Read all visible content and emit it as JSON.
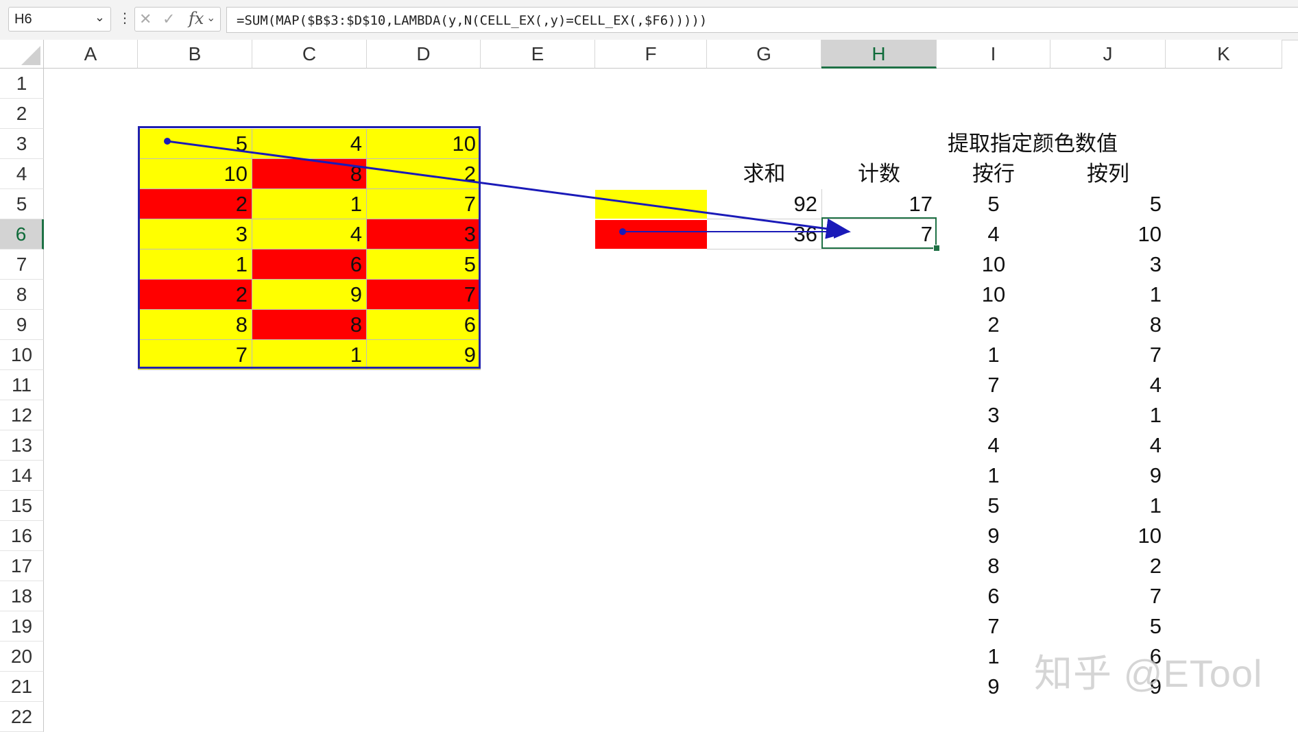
{
  "formula_bar": {
    "name_box": "H6",
    "menu_glyph": "⋮",
    "cancel_glyph": "✕",
    "enter_glyph": "✓",
    "fx_label": "fx",
    "formula": "=SUM(MAP($B$3:$D$10,LAMBDA(y,N(CELL_EX(,y)=CELL_EX(,$F6)))))"
  },
  "columns": [
    "A",
    "B",
    "C",
    "D",
    "E",
    "F",
    "G",
    "H",
    "I",
    "J",
    "K"
  ],
  "active_column": "H",
  "rows": [
    "1",
    "2",
    "3",
    "4",
    "5",
    "6",
    "7",
    "8",
    "9",
    "10",
    "11",
    "12",
    "13",
    "14",
    "15",
    "16",
    "17",
    "18",
    "19",
    "20",
    "21",
    "22"
  ],
  "active_row": "6",
  "colors": {
    "yellow": "#ffff00",
    "red": "#ff0000",
    "border": "#2020b0",
    "selection": "#1e7145"
  },
  "data_table": {
    "rows": [
      [
        {
          "v": "5",
          "c": "yellow"
        },
        {
          "v": "4",
          "c": "yellow"
        },
        {
          "v": "10",
          "c": "yellow"
        }
      ],
      [
        {
          "v": "10",
          "c": "yellow"
        },
        {
          "v": "8",
          "c": "red"
        },
        {
          "v": "2",
          "c": "yellow"
        }
      ],
      [
        {
          "v": "2",
          "c": "red"
        },
        {
          "v": "1",
          "c": "yellow"
        },
        {
          "v": "7",
          "c": "yellow"
        }
      ],
      [
        {
          "v": "3",
          "c": "yellow"
        },
        {
          "v": "4",
          "c": "yellow"
        },
        {
          "v": "3",
          "c": "red"
        }
      ],
      [
        {
          "v": "1",
          "c": "yellow"
        },
        {
          "v": "6",
          "c": "red"
        },
        {
          "v": "5",
          "c": "yellow"
        }
      ],
      [
        {
          "v": "2",
          "c": "red"
        },
        {
          "v": "9",
          "c": "yellow"
        },
        {
          "v": "7",
          "c": "red"
        }
      ],
      [
        {
          "v": "8",
          "c": "yellow"
        },
        {
          "v": "8",
          "c": "red"
        },
        {
          "v": "6",
          "c": "yellow"
        }
      ],
      [
        {
          "v": "7",
          "c": "yellow"
        },
        {
          "v": "1",
          "c": "yellow"
        },
        {
          "v": "9",
          "c": "yellow"
        }
      ]
    ]
  },
  "summary": {
    "header_sum": "求和",
    "header_count": "计数",
    "rows": [
      {
        "color": "yellow",
        "sum": "92",
        "count": "17"
      },
      {
        "color": "red",
        "sum": "36",
        "count": "7"
      }
    ]
  },
  "extract": {
    "title": "提取指定颜色数值",
    "by_row_label": "按行",
    "by_col_label": "按列",
    "by_row": [
      "5",
      "4",
      "10",
      "10",
      "2",
      "1",
      "7",
      "3",
      "4",
      "1",
      "5",
      "9",
      "8",
      "6",
      "7",
      "1",
      "9"
    ],
    "by_col": [
      "5",
      "10",
      "3",
      "1",
      "8",
      "7",
      "4",
      "1",
      "4",
      "9",
      "1",
      "10",
      "2",
      "7",
      "5",
      "6",
      "9"
    ]
  },
  "watermark": "知乎 @ETool"
}
